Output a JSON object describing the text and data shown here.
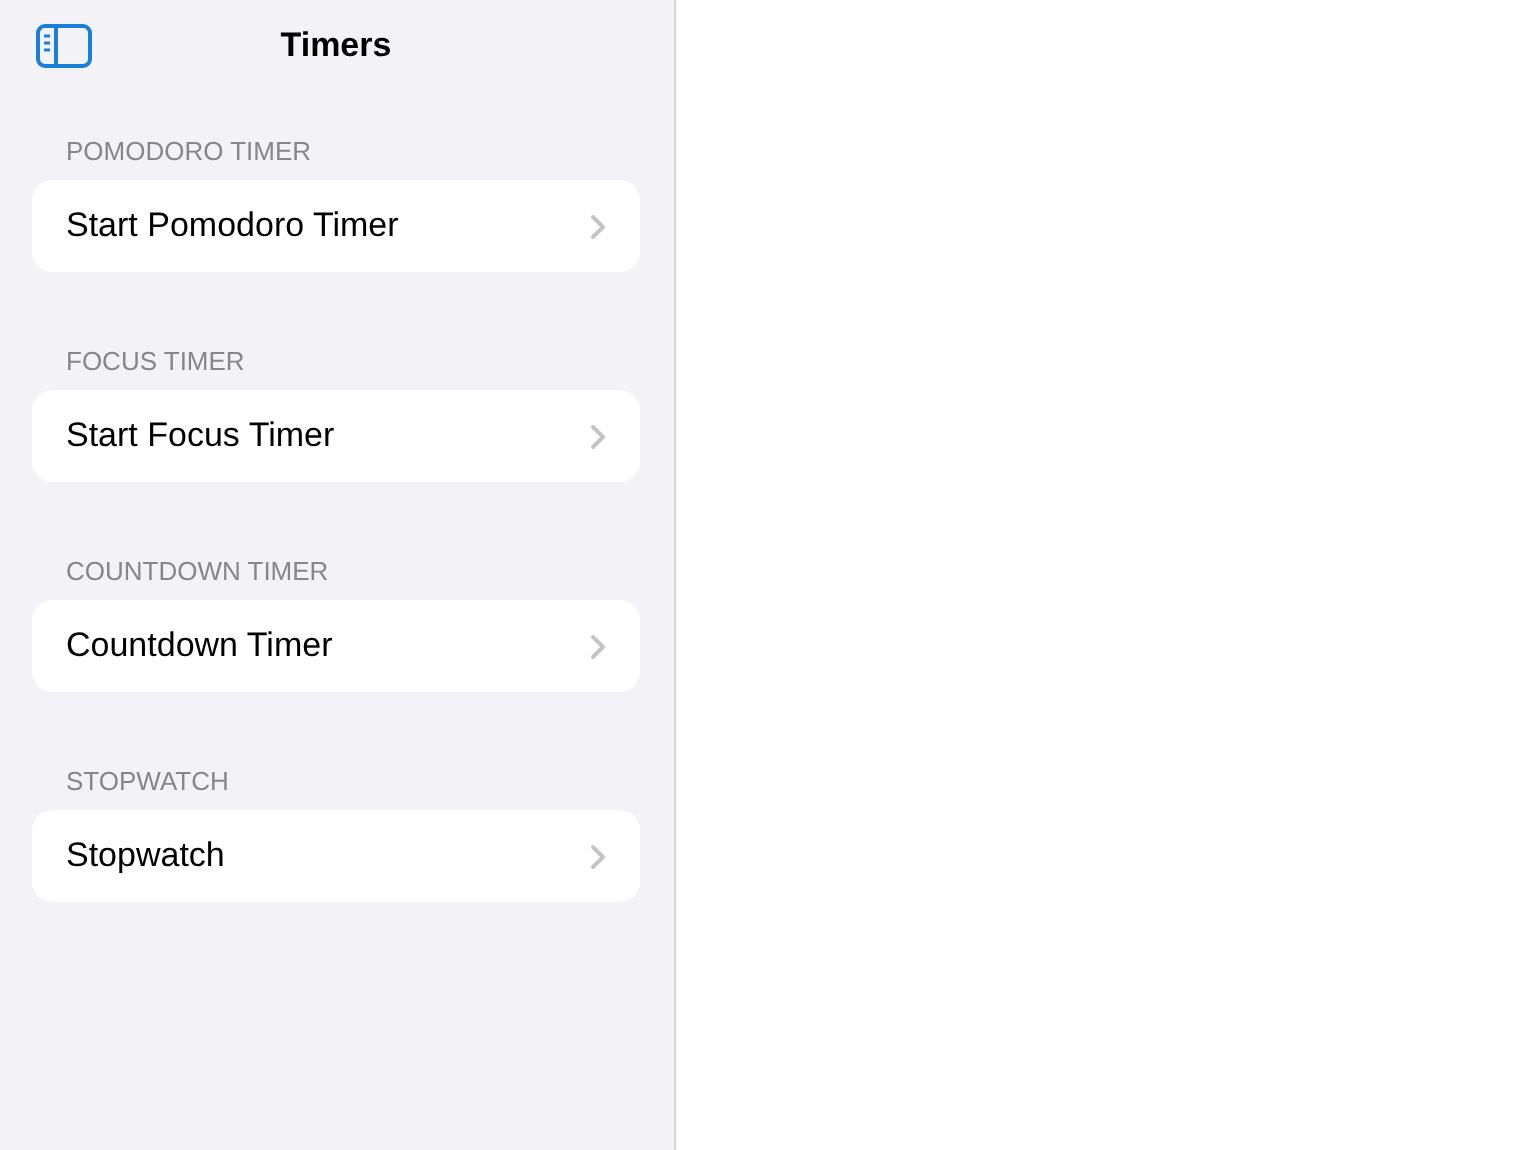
{
  "sidebar": {
    "title": "Timers",
    "sections": [
      {
        "header": "POMODORO TIMER",
        "items": [
          {
            "label": "Start Pomodoro Timer"
          }
        ]
      },
      {
        "header": "FOCUS TIMER",
        "items": [
          {
            "label": "Start Focus Timer"
          }
        ]
      },
      {
        "header": "COUNTDOWN TIMER",
        "items": [
          {
            "label": "Countdown Timer"
          }
        ]
      },
      {
        "header": "STOPWATCH",
        "items": [
          {
            "label": "Stopwatch"
          }
        ]
      }
    ]
  }
}
